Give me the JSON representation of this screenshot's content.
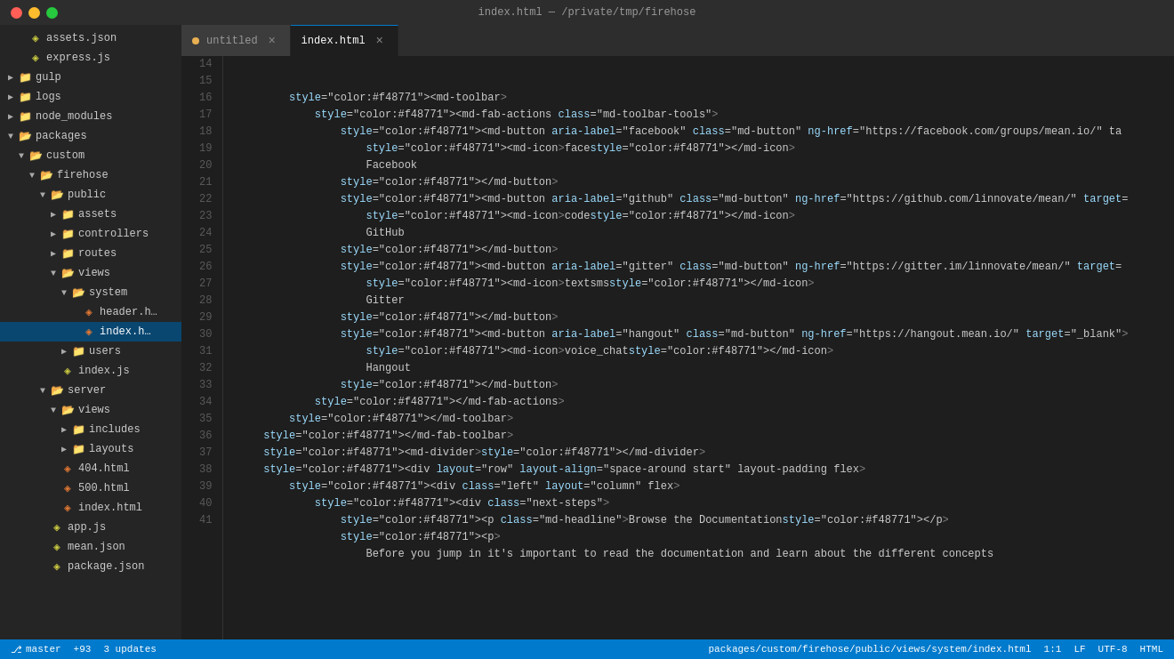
{
  "titlebar": {
    "title": "index.html — /private/tmp/firehose"
  },
  "tabs": [
    {
      "id": "untitled",
      "label": "untitled",
      "active": false,
      "modified": true
    },
    {
      "id": "index.html",
      "label": "index.html",
      "active": true,
      "modified": false
    }
  ],
  "sidebar": {
    "items": [
      {
        "id": "assets-json",
        "indent": 1,
        "type": "file",
        "label": "assets.json",
        "icon": "json",
        "arrow": ""
      },
      {
        "id": "express-js",
        "indent": 1,
        "type": "file",
        "label": "express.js",
        "icon": "js",
        "arrow": ""
      },
      {
        "id": "gulp",
        "indent": 0,
        "type": "folder-closed",
        "label": "gulp",
        "arrow": "▶"
      },
      {
        "id": "logs",
        "indent": 0,
        "type": "folder-closed",
        "label": "logs",
        "arrow": "▶"
      },
      {
        "id": "node-modules",
        "indent": 0,
        "type": "folder-closed",
        "label": "node_modules",
        "arrow": "▶"
      },
      {
        "id": "packages",
        "indent": 0,
        "type": "folder-open",
        "label": "packages",
        "arrow": "▼"
      },
      {
        "id": "custom",
        "indent": 1,
        "type": "folder-open",
        "label": "custom",
        "arrow": "▼"
      },
      {
        "id": "firehose",
        "indent": 2,
        "type": "folder-open",
        "label": "firehose",
        "arrow": "▼"
      },
      {
        "id": "public",
        "indent": 3,
        "type": "folder-open",
        "label": "public",
        "arrow": "▼"
      },
      {
        "id": "assets",
        "indent": 4,
        "type": "folder-closed",
        "label": "assets",
        "arrow": "▶"
      },
      {
        "id": "controllers",
        "indent": 4,
        "type": "folder-closed",
        "label": "controllers",
        "arrow": "▶"
      },
      {
        "id": "routes",
        "indent": 4,
        "type": "folder-closed",
        "label": "routes",
        "arrow": "▶"
      },
      {
        "id": "views",
        "indent": 4,
        "type": "folder-open",
        "label": "views",
        "arrow": "▼"
      },
      {
        "id": "system",
        "indent": 5,
        "type": "folder-open",
        "label": "system",
        "arrow": "▼"
      },
      {
        "id": "header-html",
        "indent": 6,
        "type": "file",
        "label": "header.h…",
        "icon": "html",
        "arrow": ""
      },
      {
        "id": "index-html",
        "indent": 6,
        "type": "file",
        "label": "index.h…",
        "icon": "html",
        "arrow": "",
        "active": true
      },
      {
        "id": "users",
        "indent": 5,
        "type": "folder-closed",
        "label": "users",
        "arrow": "▶"
      },
      {
        "id": "index-js",
        "indent": 4,
        "type": "file",
        "label": "index.js",
        "icon": "js",
        "arrow": ""
      },
      {
        "id": "server",
        "indent": 3,
        "type": "folder-open",
        "label": "server",
        "arrow": "▼"
      },
      {
        "id": "server-views",
        "indent": 4,
        "type": "folder-open",
        "label": "views",
        "arrow": "▼"
      },
      {
        "id": "includes",
        "indent": 5,
        "type": "folder-closed",
        "label": "includes",
        "arrow": "▶"
      },
      {
        "id": "layouts",
        "indent": 5,
        "type": "folder-closed",
        "label": "layouts",
        "arrow": "▶"
      },
      {
        "id": "404-html",
        "indent": 4,
        "type": "file",
        "label": "404.html",
        "icon": "html",
        "arrow": ""
      },
      {
        "id": "500-html",
        "indent": 4,
        "type": "file",
        "label": "500.html",
        "icon": "html",
        "arrow": ""
      },
      {
        "id": "index-html2",
        "indent": 4,
        "type": "file",
        "label": "index.html",
        "icon": "html",
        "arrow": ""
      },
      {
        "id": "app-js",
        "indent": 3,
        "type": "file",
        "label": "app.js",
        "icon": "js",
        "arrow": ""
      },
      {
        "id": "mean-json",
        "indent": 3,
        "type": "file",
        "label": "mean.json",
        "icon": "json",
        "arrow": ""
      },
      {
        "id": "package-json",
        "indent": 3,
        "type": "file",
        "label": "package.json",
        "icon": "json",
        "arrow": ""
      }
    ]
  },
  "code": {
    "lines": [
      {
        "num": 14,
        "content": "        <md-toolbar>"
      },
      {
        "num": 15,
        "content": "            <md-fab-actions class=\"md-toolbar-tools\">"
      },
      {
        "num": 16,
        "content": "                <md-button aria-label=\"facebook\" class=\"md-button\" ng-href=\"https://facebook.com/groups/mean.io/\" ta"
      },
      {
        "num": 17,
        "content": "                    <md-icon>face</md-icon>"
      },
      {
        "num": 18,
        "content": "                    Facebook"
      },
      {
        "num": 19,
        "content": "                </md-button>"
      },
      {
        "num": 20,
        "content": "                <md-button aria-label=\"github\" class=\"md-button\" ng-href=\"https://github.com/linnovate/mean/\" target="
      },
      {
        "num": 21,
        "content": "                    <md-icon>code</md-icon>"
      },
      {
        "num": 22,
        "content": "                    GitHub"
      },
      {
        "num": 23,
        "content": "                </md-button>"
      },
      {
        "num": 24,
        "content": "                <md-button aria-label=\"gitter\" class=\"md-button\" ng-href=\"https://gitter.im/linnovate/mean/\" target="
      },
      {
        "num": 25,
        "content": "                    <md-icon>textsms</md-icon>"
      },
      {
        "num": 26,
        "content": "                    Gitter"
      },
      {
        "num": 27,
        "content": "                </md-button>"
      },
      {
        "num": 28,
        "content": "                <md-button aria-label=\"hangout\" class=\"md-button\" ng-href=\"https://hangout.mean.io/\" target=\"_blank\">"
      },
      {
        "num": 29,
        "content": "                    <md-icon>voice_chat</md-icon>"
      },
      {
        "num": 30,
        "content": "                    Hangout"
      },
      {
        "num": 31,
        "content": "                </md-button>"
      },
      {
        "num": 32,
        "content": "            </md-fab-actions>"
      },
      {
        "num": 33,
        "content": "        </md-toolbar>"
      },
      {
        "num": 34,
        "content": "    </md-fab-toolbar>"
      },
      {
        "num": 35,
        "content": "    <md-divider></md-divider>"
      },
      {
        "num": 36,
        "content": "    <div layout=\"row\" layout-align=\"space-around start\" layout-padding flex>"
      },
      {
        "num": 37,
        "content": "        <div class=\"left\" layout=\"column\" flex>"
      },
      {
        "num": 38,
        "content": "            <div class=\"next-steps\">"
      },
      {
        "num": 39,
        "content": "                <p class=\"md-headline\">Browse the Documentation</p>"
      },
      {
        "num": 40,
        "content": "                <p>"
      },
      {
        "num": 41,
        "content": "                    Before you jump in it's important to read the documentation and learn about the different concepts"
      }
    ]
  },
  "statusbar": {
    "path": "packages/custom/firehose/public/views/system/index.html",
    "position": "1:1",
    "encoding": "LF",
    "charset": "UTF-8",
    "language": "HTML",
    "branch": "master",
    "sync": "+93",
    "updates": "3 updates"
  }
}
